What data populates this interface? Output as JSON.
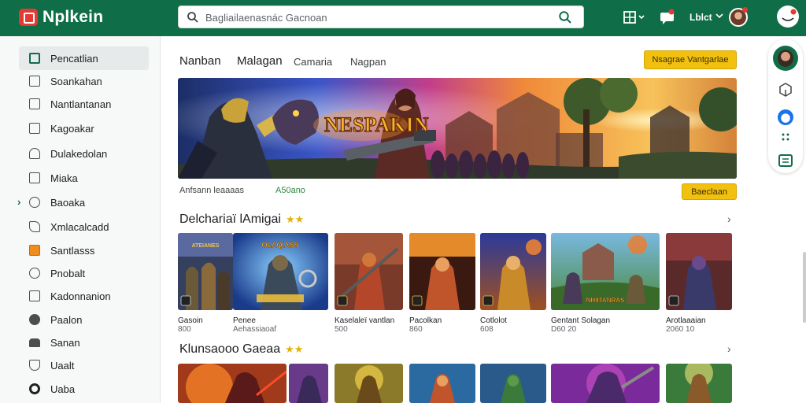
{
  "app": {
    "name": "Nplkein"
  },
  "search": {
    "placeholder": "Bagliailaenasnác Gacnoan"
  },
  "top": {
    "user_label": "Lblct"
  },
  "sidebar": {
    "items": [
      {
        "label": "Pencatlian",
        "icon": "store-icon",
        "active": true
      },
      {
        "label": "Soankahan",
        "icon": "square-icon"
      },
      {
        "label": "Nantlantanan",
        "icon": "book-icon"
      },
      {
        "label": "Kagoakar",
        "icon": "square-icon"
      },
      {
        "label": "Dulakedolan",
        "icon": "home-icon"
      },
      {
        "label": "Miaka",
        "icon": "frame-icon"
      },
      {
        "label": "Baoaka",
        "icon": "circle-icon"
      },
      {
        "label": "Xmlacalcadd",
        "icon": "tag-icon"
      },
      {
        "label": "Santlasss",
        "icon": "flag-icon"
      },
      {
        "label": "Pnobalt",
        "icon": "circle-icon"
      },
      {
        "label": "Kadonnanion",
        "icon": "window-icon"
      },
      {
        "label": "Paalon",
        "icon": "disc-icon"
      },
      {
        "label": "Sanan",
        "icon": "car-icon"
      },
      {
        "label": "Uaalt",
        "icon": "shield-icon"
      },
      {
        "label": "Uaba",
        "icon": "coin-icon"
      }
    ]
  },
  "main": {
    "tabs": [
      "Nanban",
      "Malagan",
      "Camaria",
      "Nagpan"
    ],
    "top_cta": "Nsagrae Vantgarlae",
    "banner": {
      "title": "NESPAKIN",
      "caption": "Anfsann leaaaas",
      "meta": "A50ano",
      "cta": "Baeclaan"
    },
    "section1": {
      "title": "Delchariaï lAmigai",
      "cards": [
        {
          "title": "Gasoin",
          "meta": "800",
          "art": "ATEIANES"
        },
        {
          "title": "Penee",
          "meta": "Aehassiaoaf",
          "art": "OLAQIASS"
        },
        {
          "title": "Kaselaleï vantlan",
          "meta": "500",
          "art": ""
        },
        {
          "title": "Pacolkan",
          "meta": "860",
          "art": ""
        },
        {
          "title": "Cotlolot",
          "meta": "608",
          "art": ""
        },
        {
          "title": "Gentant Solagan",
          "meta": "D60 20",
          "art": "NHIITANRAS"
        },
        {
          "title": "Arotlaaaian",
          "meta": "2060 10",
          "art": ""
        }
      ]
    },
    "section2": {
      "title": "Klunsaooo Gaeaa"
    }
  },
  "colors": {
    "brand": "#0f6e47",
    "accent": "#f2c00f",
    "alert": "#e53935"
  }
}
